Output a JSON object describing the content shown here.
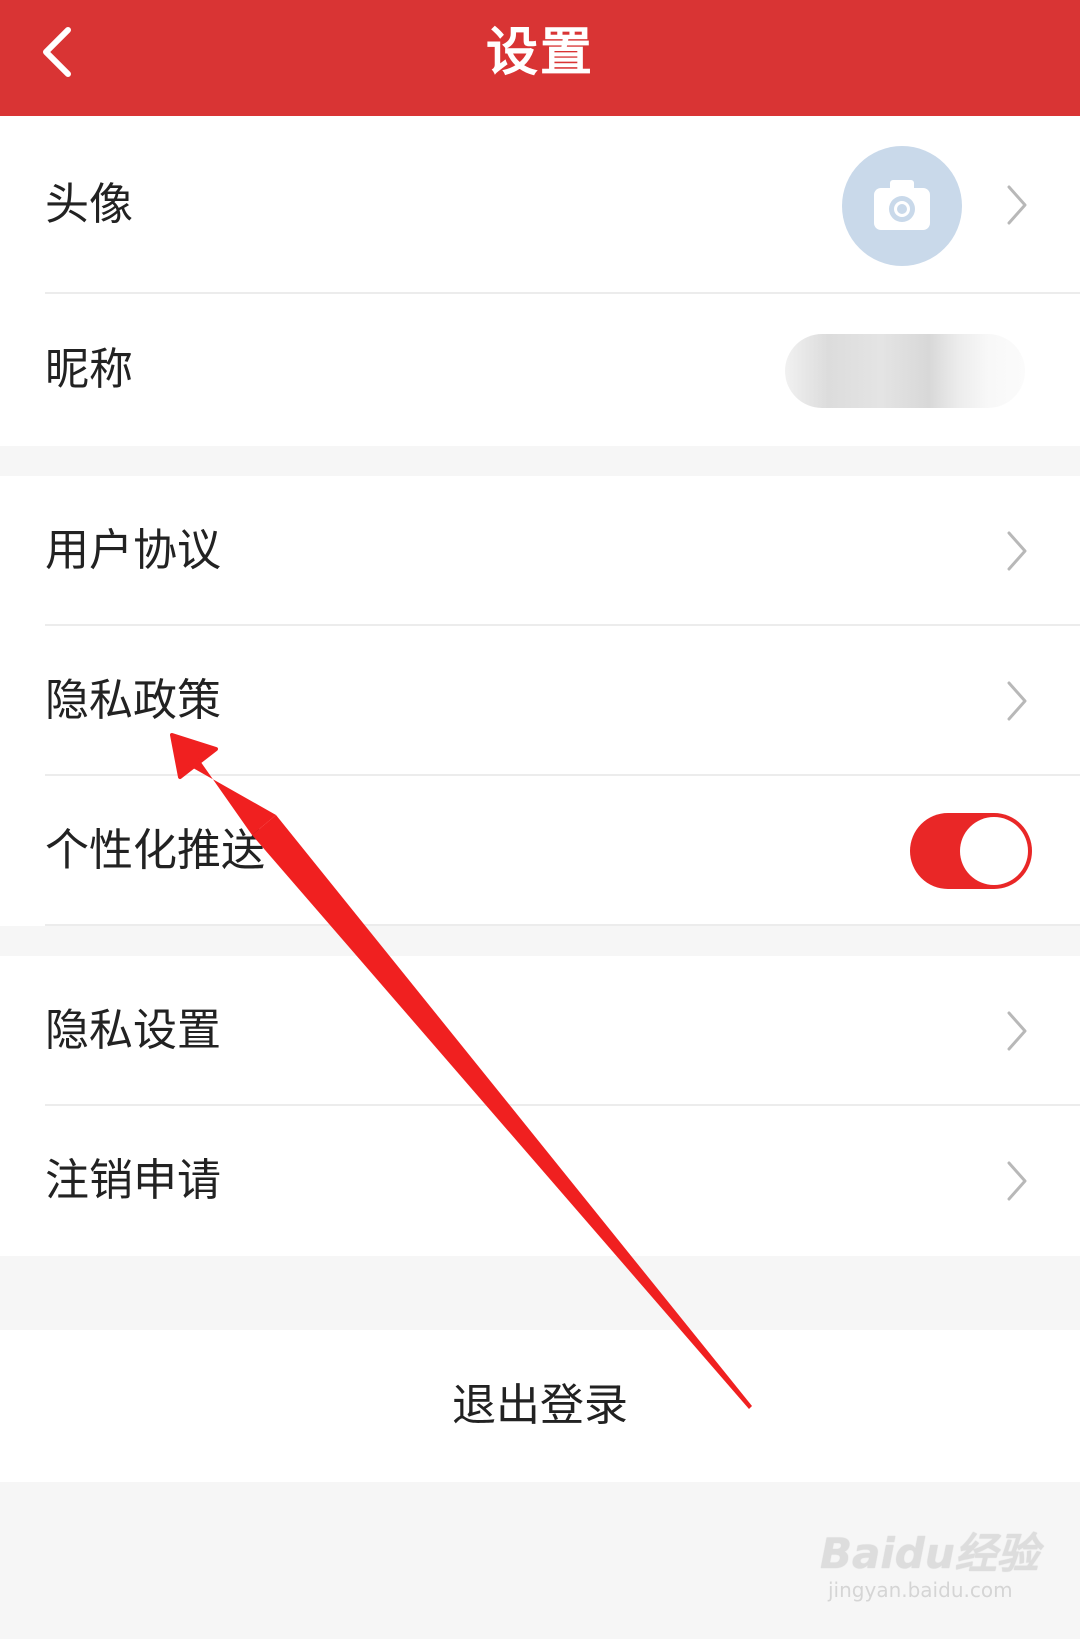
{
  "header": {
    "title": "设置",
    "back_icon": "chevron-left-icon"
  },
  "profile": {
    "avatar_label": "头像",
    "avatar_icon": "camera-icon",
    "nickname_label": "昵称",
    "nickname_value_state": "blurred"
  },
  "settings": {
    "user_agreement": "用户协议",
    "privacy_policy": "隐私政策",
    "personalized_push": "个性化推送",
    "personalized_push_enabled": true
  },
  "account": {
    "privacy_settings": "隐私设置",
    "deactivate_account": "注销申请"
  },
  "logout": {
    "label": "退出登录"
  },
  "watermark": {
    "logo": "Baidu经验",
    "url": "jingyan.baidu.com"
  },
  "colors": {
    "header_bg": "#d93434",
    "toggle_on": "#e92727",
    "avatar_bg": "#c9d9ea",
    "annotation_arrow": "#f02020"
  }
}
